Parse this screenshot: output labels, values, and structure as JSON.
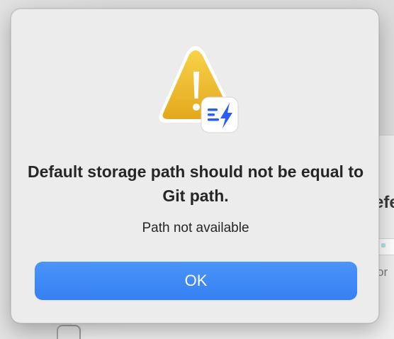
{
  "dialog": {
    "title": "Default storage path should not be equal to Git path.",
    "message": "Path not available",
    "ok_label": "OK",
    "icon": "warning-triangle-icon",
    "app_badge_icon": "app-badge-icon"
  },
  "background_window": {
    "title_fragment": "efe",
    "text_fragment": "or"
  },
  "colors": {
    "accent": "#3a86f5",
    "warning": "#f0b92d",
    "badge_blue": "#2a5cf7"
  }
}
